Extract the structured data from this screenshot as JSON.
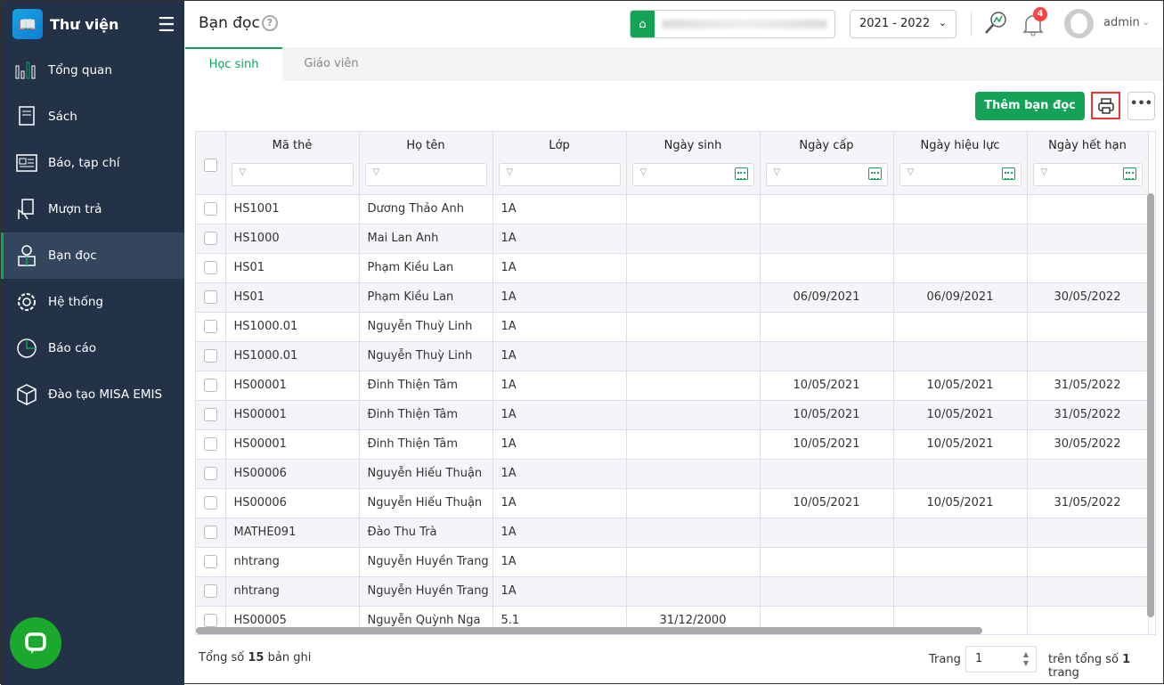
{
  "app": {
    "title": "Thư viện"
  },
  "sidebar": {
    "items": [
      {
        "label": "Tổng quan",
        "icon": "bar-chart-icon"
      },
      {
        "label": "Sách",
        "icon": "book-icon"
      },
      {
        "label": "Báo, tạp chí",
        "icon": "newspaper-icon"
      },
      {
        "label": "Mượn trả",
        "icon": "hand-book-icon"
      },
      {
        "label": "Bạn đọc",
        "icon": "reader-icon",
        "active": true
      },
      {
        "label": "Hệ thống",
        "icon": "gear-icon"
      },
      {
        "label": "Báo cáo",
        "icon": "pie-chart-icon"
      },
      {
        "label": "Đào tạo MISA EMIS",
        "icon": "cube-icon"
      }
    ]
  },
  "header": {
    "title": "Bạn đọc",
    "year": "2021 - 2022",
    "notifications": "4",
    "user": "admin"
  },
  "tabs": [
    {
      "label": "Học sinh",
      "active": true
    },
    {
      "label": "Giáo viên"
    }
  ],
  "toolbar": {
    "add_label": "Thêm bạn đọc"
  },
  "colors": {
    "accent": "#12a356",
    "sidebar": "#243248",
    "badge": "#ff4444"
  },
  "table": {
    "columns": [
      "Mã thẻ",
      "Họ tên",
      "Lớp",
      "Ngày sinh",
      "Ngày cấp",
      "Ngày hiệu lực",
      "Ngày hết hạn"
    ],
    "rows": [
      [
        "HS1001",
        "Dương Thảo Anh",
        "1A",
        "",
        "",
        "",
        ""
      ],
      [
        "HS1000",
        "Mai Lan Anh",
        "1A",
        "",
        "",
        "",
        ""
      ],
      [
        "HS01",
        "Phạm Kiều Lan",
        "1A",
        "",
        "",
        "",
        ""
      ],
      [
        "HS01",
        "Phạm Kiều Lan",
        "1A",
        "",
        "06/09/2021",
        "06/09/2021",
        "30/05/2022"
      ],
      [
        "HS1000.01",
        "Nguyễn Thuỳ Linh",
        "1A",
        "",
        "",
        "",
        ""
      ],
      [
        "HS1000.01",
        "Nguyễn Thuỳ Linh",
        "1A",
        "",
        "",
        "",
        ""
      ],
      [
        "HS00001",
        "Đinh Thiện Tâm",
        "1A",
        "",
        "10/05/2021",
        "10/05/2021",
        "31/05/2022"
      ],
      [
        "HS00001",
        "Đinh Thiện Tâm",
        "1A",
        "",
        "10/05/2021",
        "10/05/2021",
        "31/05/2022"
      ],
      [
        "HS00001",
        "Đinh Thiện Tâm",
        "1A",
        "",
        "10/05/2021",
        "10/05/2021",
        "30/05/2022"
      ],
      [
        "HS00006",
        "Nguyễn Hiếu Thuận",
        "1A",
        "",
        "",
        "",
        ""
      ],
      [
        "HS00006",
        "Nguyễn Hiếu Thuận",
        "1A",
        "",
        "10/05/2021",
        "10/05/2021",
        "31/05/2022"
      ],
      [
        "MATHE091",
        "Đào Thu Trà",
        "1A",
        "",
        "",
        "",
        ""
      ],
      [
        "nhtrang",
        "Nguyễn Huyền Trang",
        "1A",
        "",
        "",
        "",
        ""
      ],
      [
        "nhtrang",
        "Nguyễn Huyền Trang",
        "1A",
        "",
        "",
        "",
        ""
      ],
      [
        "HS00005",
        "Nguyễn Quỳnh Nga",
        "5.1",
        "31/12/2000",
        "",
        "",
        ""
      ]
    ]
  },
  "footer": {
    "total_prefix": "Tổng số",
    "total": "15",
    "total_suffix": "bản ghi",
    "page_label": "Trang",
    "page": "1",
    "pages_prefix": "trên tổng số",
    "pages": "1",
    "pages_suffix": "trang"
  }
}
